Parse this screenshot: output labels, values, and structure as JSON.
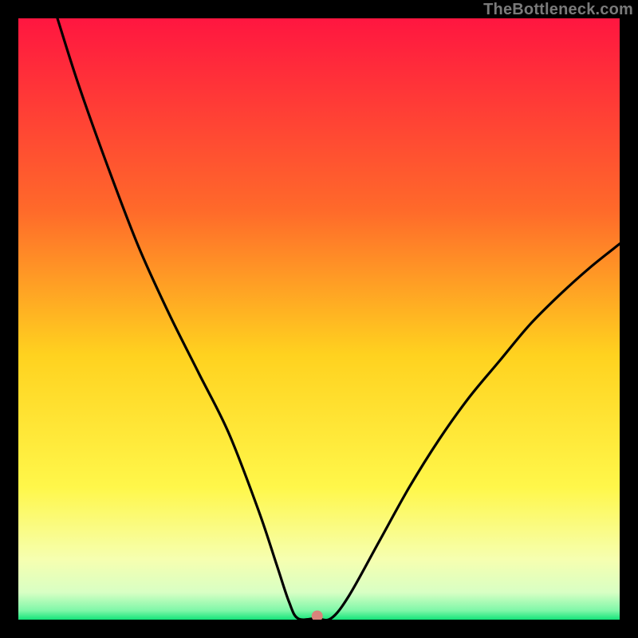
{
  "watermark": "TheBottleneck.com",
  "chart_data": {
    "type": "line",
    "title": "",
    "xlabel": "",
    "ylabel": "",
    "xlim": [
      0,
      100
    ],
    "ylim": [
      0,
      100
    ],
    "grid": false,
    "legend": false,
    "background_gradient_stops": [
      {
        "pos": 0.0,
        "color": "#ff1640"
      },
      {
        "pos": 0.32,
        "color": "#ff6a2a"
      },
      {
        "pos": 0.56,
        "color": "#ffd21f"
      },
      {
        "pos": 0.78,
        "color": "#fff74a"
      },
      {
        "pos": 0.9,
        "color": "#f6ffb0"
      },
      {
        "pos": 0.955,
        "color": "#d8ffc4"
      },
      {
        "pos": 0.985,
        "color": "#7ef7a8"
      },
      {
        "pos": 1.0,
        "color": "#14e47a"
      }
    ],
    "series": [
      {
        "name": "bottleneck-curve",
        "color": "#000000",
        "x": [
          6.5,
          10,
          15,
          20,
          25,
          30,
          35,
          40,
          43,
          45,
          46.5,
          49.5,
          52,
          55,
          60,
          65,
          70,
          75,
          80,
          85,
          90,
          95,
          100
        ],
        "y": [
          100,
          89,
          75,
          62,
          51,
          41,
          31,
          18,
          9,
          3,
          0.2,
          0.2,
          0.2,
          4,
          13,
          22,
          30,
          37,
          43,
          49,
          54,
          58.5,
          62.5
        ]
      }
    ],
    "marker": {
      "x": 49.7,
      "y": 0.6,
      "color": "#d9837b",
      "radius_px": 7
    }
  }
}
